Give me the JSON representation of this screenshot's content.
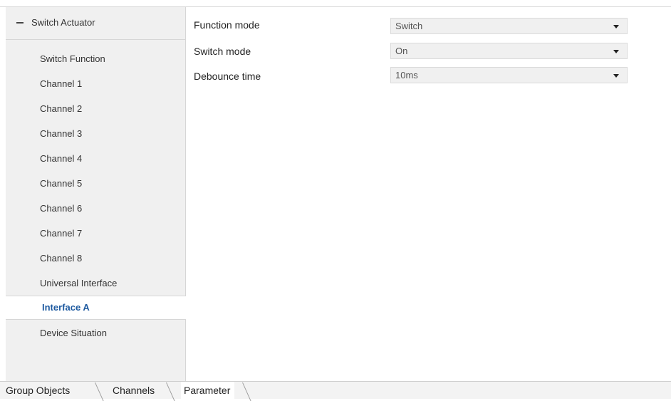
{
  "sidebar": {
    "header": {
      "label": "Switch Actuator",
      "icon": "collapse-minus-icon"
    },
    "items": [
      {
        "label": "Switch Function",
        "active": false
      },
      {
        "label": "Channel 1",
        "active": false
      },
      {
        "label": "Channel 2",
        "active": false
      },
      {
        "label": "Channel 3",
        "active": false
      },
      {
        "label": "Channel 4",
        "active": false
      },
      {
        "label": "Channel 5",
        "active": false
      },
      {
        "label": "Channel 6",
        "active": false
      },
      {
        "label": "Channel 7",
        "active": false
      },
      {
        "label": "Channel 8",
        "active": false
      },
      {
        "label": "Universal Interface",
        "active": false
      },
      {
        "label": "Interface A",
        "active": true
      },
      {
        "label": "Device Situation",
        "active": false
      }
    ]
  },
  "parameters": [
    {
      "label": "Function mode",
      "value": "Switch"
    },
    {
      "label": "Switch mode",
      "value": "On"
    },
    {
      "label": "Debounce time",
      "value": "10ms"
    }
  ],
  "tabs": [
    {
      "label": "Group Objects",
      "active": false
    },
    {
      "label": "Channels",
      "active": false
    },
    {
      "label": "Parameter",
      "active": true
    }
  ],
  "colors": {
    "active_item_text": "#1e5aa0",
    "sidebar_bg": "#f0f0f0",
    "select_bg": "#f0f0f0"
  }
}
